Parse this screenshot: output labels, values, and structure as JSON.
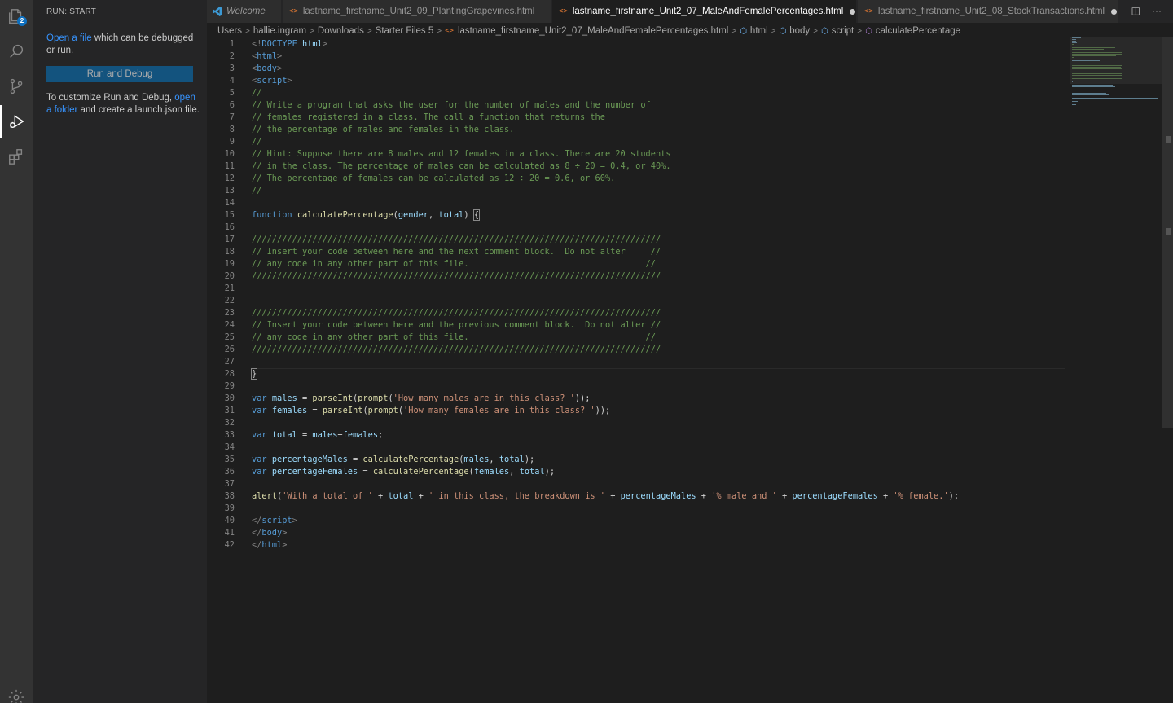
{
  "activity_bar": {
    "explorer_badge": "2"
  },
  "sidebar": {
    "title": "RUN: START",
    "open_file_link": "Open a file",
    "open_file_rest": " which can be debugged or run.",
    "run_button": "Run and Debug",
    "customize_text": "To customize Run and Debug, ",
    "open_folder_link": "open a folder",
    "customize_rest": " and create a launch.json file."
  },
  "tabs": [
    {
      "label": "Welcome"
    },
    {
      "label": "lastname_firstname_Unit2_09_PlantingGrapevines.html"
    },
    {
      "label": "lastname_firstname_Unit2_07_MaleAndFemalePercentages.html"
    },
    {
      "label": "lastname_firstname_Unit2_08_StockTransactions.html"
    }
  ],
  "tab_actions": {
    "split": "◫",
    "more": "···"
  },
  "breadcrumb": {
    "users": "Users",
    "user": "hallie.ingram",
    "downloads": "Downloads",
    "starter": "Starter Files 5",
    "file": "lastname_firstname_Unit2_07_MaleAndFemalePercentages.html",
    "html": "html",
    "body": "body",
    "script": "script",
    "func": "calculatePercentage"
  },
  "code": {
    "line_numbers": [
      "1",
      "2",
      "3",
      "4",
      "5",
      "6",
      "7",
      "8",
      "9",
      "10",
      "11",
      "12",
      "13",
      "14",
      "15",
      "16",
      "17",
      "18",
      "19",
      "20",
      "21",
      "22",
      "23",
      "24",
      "25",
      "26",
      "27",
      "28",
      "29",
      "30",
      "31",
      "32",
      "33",
      "34",
      "35",
      "36",
      "37",
      "38",
      "39",
      "40",
      "41",
      "42"
    ],
    "lines": [
      [
        [
          "punc",
          "<!"
        ],
        [
          "tag",
          "DOCTYPE"
        ],
        [
          "plain",
          " "
        ],
        [
          "attr",
          "html"
        ],
        [
          "punc",
          ">"
        ]
      ],
      [
        [
          "punc",
          "<"
        ],
        [
          "tag",
          "html"
        ],
        [
          "punc",
          ">"
        ]
      ],
      [
        [
          "punc",
          "<"
        ],
        [
          "tag",
          "body"
        ],
        [
          "punc",
          ">"
        ]
      ],
      [
        [
          "punc",
          "<"
        ],
        [
          "tag",
          "script"
        ],
        [
          "punc",
          ">"
        ]
      ],
      [
        [
          "com",
          "//"
        ]
      ],
      [
        [
          "com",
          "// Write a program that asks the user for the number of males and the number of"
        ]
      ],
      [
        [
          "com",
          "// females registered in a class. The call a function that returns the"
        ]
      ],
      [
        [
          "com",
          "// the percentage of males and females in the class."
        ]
      ],
      [
        [
          "com",
          "//"
        ]
      ],
      [
        [
          "com",
          "// Hint: Suppose there are 8 males and 12 females in a class. There are 20 students"
        ]
      ],
      [
        [
          "com",
          "// in the class. The percentage of males can be calculated as 8 ÷ 20 = 0.4, or 40%."
        ]
      ],
      [
        [
          "com",
          "// The percentage of females can be calculated as 12 ÷ 20 = 0.6, or 60%."
        ]
      ],
      [
        [
          "com",
          "//"
        ]
      ],
      [],
      [
        [
          "kw",
          "function"
        ],
        [
          "plain",
          " "
        ],
        [
          "fn",
          "calculatePercentage"
        ],
        [
          "plain",
          "("
        ],
        [
          "var",
          "gender"
        ],
        [
          "plain",
          ", "
        ],
        [
          "var",
          "total"
        ],
        [
          "plain",
          ") "
        ],
        [
          "cursor",
          "{"
        ]
      ],
      [],
      [
        [
          "com",
          "/////////////////////////////////////////////////////////////////////////////////"
        ]
      ],
      [
        [
          "com",
          "// Insert your code between here and the next comment block.  Do not alter     //"
        ]
      ],
      [
        [
          "com",
          "// any code in any other part of this file.                                   //"
        ]
      ],
      [
        [
          "com",
          "/////////////////////////////////////////////////////////////////////////////////"
        ]
      ],
      [],
      [],
      [
        [
          "com",
          "/////////////////////////////////////////////////////////////////////////////////"
        ]
      ],
      [
        [
          "com",
          "// Insert your code between here and the previous comment block.  Do not alter //"
        ]
      ],
      [
        [
          "com",
          "// any code in any other part of this file.                                   //"
        ]
      ],
      [
        [
          "com",
          "/////////////////////////////////////////////////////////////////////////////////"
        ]
      ],
      [],
      [
        [
          "cursor",
          "}"
        ]
      ],
      [],
      [
        [
          "kw",
          "var"
        ],
        [
          "plain",
          " "
        ],
        [
          "var",
          "males"
        ],
        [
          "plain",
          " = "
        ],
        [
          "fn",
          "parseInt"
        ],
        [
          "plain",
          "("
        ],
        [
          "fn",
          "prompt"
        ],
        [
          "plain",
          "("
        ],
        [
          "str",
          "'How many males are in this class? '"
        ],
        [
          "plain",
          "));"
        ]
      ],
      [
        [
          "kw",
          "var"
        ],
        [
          "plain",
          " "
        ],
        [
          "var",
          "females"
        ],
        [
          "plain",
          " = "
        ],
        [
          "fn",
          "parseInt"
        ],
        [
          "plain",
          "("
        ],
        [
          "fn",
          "prompt"
        ],
        [
          "plain",
          "("
        ],
        [
          "str",
          "'How many females are in this class? '"
        ],
        [
          "plain",
          "));"
        ]
      ],
      [],
      [
        [
          "kw",
          "var"
        ],
        [
          "plain",
          " "
        ],
        [
          "var",
          "total"
        ],
        [
          "plain",
          " = "
        ],
        [
          "var",
          "males"
        ],
        [
          "plain",
          "+"
        ],
        [
          "var",
          "females"
        ],
        [
          "plain",
          ";"
        ]
      ],
      [],
      [
        [
          "kw",
          "var"
        ],
        [
          "plain",
          " "
        ],
        [
          "var",
          "percentageMales"
        ],
        [
          "plain",
          " = "
        ],
        [
          "fn",
          "calculatePercentage"
        ],
        [
          "plain",
          "("
        ],
        [
          "var",
          "males"
        ],
        [
          "plain",
          ", "
        ],
        [
          "var",
          "total"
        ],
        [
          "plain",
          ");"
        ]
      ],
      [
        [
          "kw",
          "var"
        ],
        [
          "plain",
          " "
        ],
        [
          "var",
          "percentageFemales"
        ],
        [
          "plain",
          " = "
        ],
        [
          "fn",
          "calculatePercentage"
        ],
        [
          "plain",
          "("
        ],
        [
          "var",
          "females"
        ],
        [
          "plain",
          ", "
        ],
        [
          "var",
          "total"
        ],
        [
          "plain",
          ");"
        ]
      ],
      [],
      [
        [
          "fn",
          "alert"
        ],
        [
          "plain",
          "("
        ],
        [
          "str",
          "'With a total of '"
        ],
        [
          "plain",
          " + "
        ],
        [
          "var",
          "total"
        ],
        [
          "plain",
          " + "
        ],
        [
          "str",
          "' in this class, the breakdown is '"
        ],
        [
          "plain",
          " + "
        ],
        [
          "var",
          "percentageMales"
        ],
        [
          "plain",
          " + "
        ],
        [
          "str",
          "'% male and '"
        ],
        [
          "plain",
          " + "
        ],
        [
          "var",
          "percentageFemales"
        ],
        [
          "plain",
          " + "
        ],
        [
          "str",
          "'% female.'"
        ],
        [
          "plain",
          ");"
        ]
      ],
      [],
      [
        [
          "punc",
          "</"
        ],
        [
          "tag",
          "script"
        ],
        [
          "punc",
          ">"
        ]
      ],
      [
        [
          "punc",
          "</"
        ],
        [
          "tag",
          "body"
        ],
        [
          "punc",
          ">"
        ]
      ],
      [
        [
          "punc",
          "</"
        ],
        [
          "tag",
          "html"
        ],
        [
          "punc",
          ">"
        ]
      ]
    ]
  },
  "colors": {
    "editor_bg": "#1e1e1e",
    "sidebar_bg": "#252526",
    "activity_bg": "#333333",
    "link": "#3794ff",
    "button": "#0e639c"
  }
}
